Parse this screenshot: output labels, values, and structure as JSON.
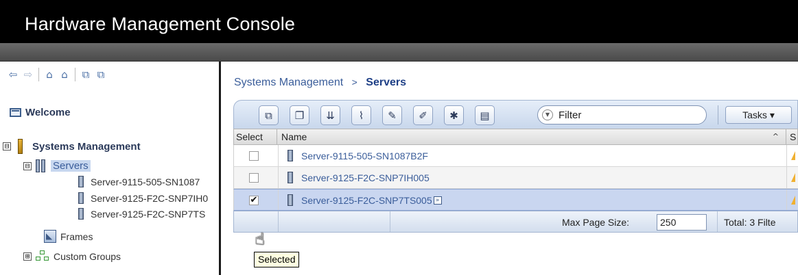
{
  "app": {
    "title": "Hardware Management Console"
  },
  "nav": {
    "toolbar_icons": [
      "back-arrow-icon",
      "forward-arrow-icon",
      "home-icon",
      "home-set-icon",
      "expand-all-icon",
      "collapse-all-icon"
    ],
    "welcome": "Welcome",
    "systems_management": "Systems Management",
    "servers": "Servers",
    "server_items": [
      "Server-9115-505-SN1087",
      "Server-9125-F2C-SNP7IH0",
      "Server-9125-F2C-SNP7TS"
    ],
    "frames": "Frames",
    "custom_groups": "Custom Groups",
    "expanded_symbol": "⊟",
    "collapsed_symbol": "⊞"
  },
  "breadcrumb": {
    "parent": "Systems Management",
    "separator": ">",
    "current": "Servers"
  },
  "toolbar": {
    "filter_placeholder": "Filter",
    "tasks_label": "Tasks ▾"
  },
  "table": {
    "col_select": "Select",
    "col_name": "Name",
    "col_status_partial": "S",
    "rows": [
      {
        "name": "Server-9115-505-SN1087B2F",
        "checked": "",
        "selected": false
      },
      {
        "name": "Server-9125-F2C-SNP7IH005",
        "checked": "",
        "selected": false
      },
      {
        "name": "Server-9125-F2C-SNP7TS005",
        "checked": "✔",
        "selected": true
      }
    ],
    "footer": {
      "max_page_size_label": "Max Page Size:",
      "max_page_size_value": "250",
      "total_label": "Total: 3  Filte"
    }
  },
  "tooltip": {
    "text": "Selected"
  },
  "colors": {
    "link": "#3a5d9a",
    "selection": "#c9d6f0",
    "warning": "#f0b030"
  }
}
